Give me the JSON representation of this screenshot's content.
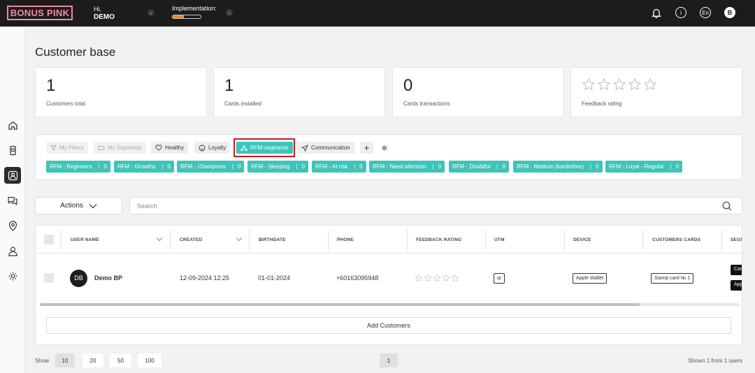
{
  "header": {
    "logo": "BONUS PINK",
    "greeting": "Hi,",
    "user_name": "DEMO",
    "implementation_label": "Implementation:",
    "implementation_progress": 0.4,
    "language": "En",
    "avatar_letter": "B"
  },
  "page_title": "Customer base",
  "stats": [
    {
      "value": "1",
      "label": "Customers total"
    },
    {
      "value": "1",
      "label": "Cards installed"
    },
    {
      "value": "0",
      "label": "Cards transactions"
    },
    {
      "label": "Feedback rating",
      "rating": 0,
      "max": 5
    }
  ],
  "filters": {
    "my_filters": "My Filters",
    "my_segments": "My Segments",
    "healthy": "Healthy",
    "loyalty": "Loyalty",
    "rfm": "RFM-segments",
    "communication": "Communication",
    "add": "+"
  },
  "segments": [
    {
      "label": "RFM - Beginners",
      "count": "0"
    },
    {
      "label": "RFM - Growths",
      "count": "0"
    },
    {
      "label": "RFM - Champions",
      "count": "0"
    },
    {
      "label": "RFM - Sleeping",
      "count": "0"
    },
    {
      "label": "RFM - At risk",
      "count": "0"
    },
    {
      "label": "RFM - Need attention",
      "count": "0"
    },
    {
      "label": "RFM - Doubtful",
      "count": "0"
    },
    {
      "label": "RFM - Medium (borderline)",
      "count": "0"
    },
    {
      "label": "RFM - Loyal - Regular",
      "count": "0"
    }
  ],
  "actions_label": "Actions",
  "search": {
    "placeholder": "Search",
    "value": ""
  },
  "table": {
    "columns": [
      "USER NAME",
      "CREATED",
      "BIRTHDATE",
      "PHONE",
      "FEEDBACK RATING",
      "UTM",
      "DEVICE",
      "CUSTOMERS CARDS",
      "SEGM"
    ],
    "rows": [
      {
        "initials": "DB",
        "name": "Demo BP",
        "created": "12-09-2024 12:25",
        "birthdate": "01-01-2024",
        "phone": "+60163095948",
        "rating": 0,
        "utm": "qr",
        "device": "Apple Wallet",
        "card": "Stamp card № 1",
        "segment_1": "Can",
        "segment_2": "App"
      }
    ],
    "add_button": "Add Customers"
  },
  "pagination": {
    "show_label": "Show",
    "sizes": [
      "10",
      "20",
      "50",
      "100"
    ],
    "active_size": "10",
    "current_page": "1",
    "summary": "Shown 1 from 1 users"
  },
  "colors": {
    "accent": "#3ec4b8",
    "brand": "#f08aa0",
    "highlight": "#d0191b",
    "topbar": "#1c1c1c"
  }
}
